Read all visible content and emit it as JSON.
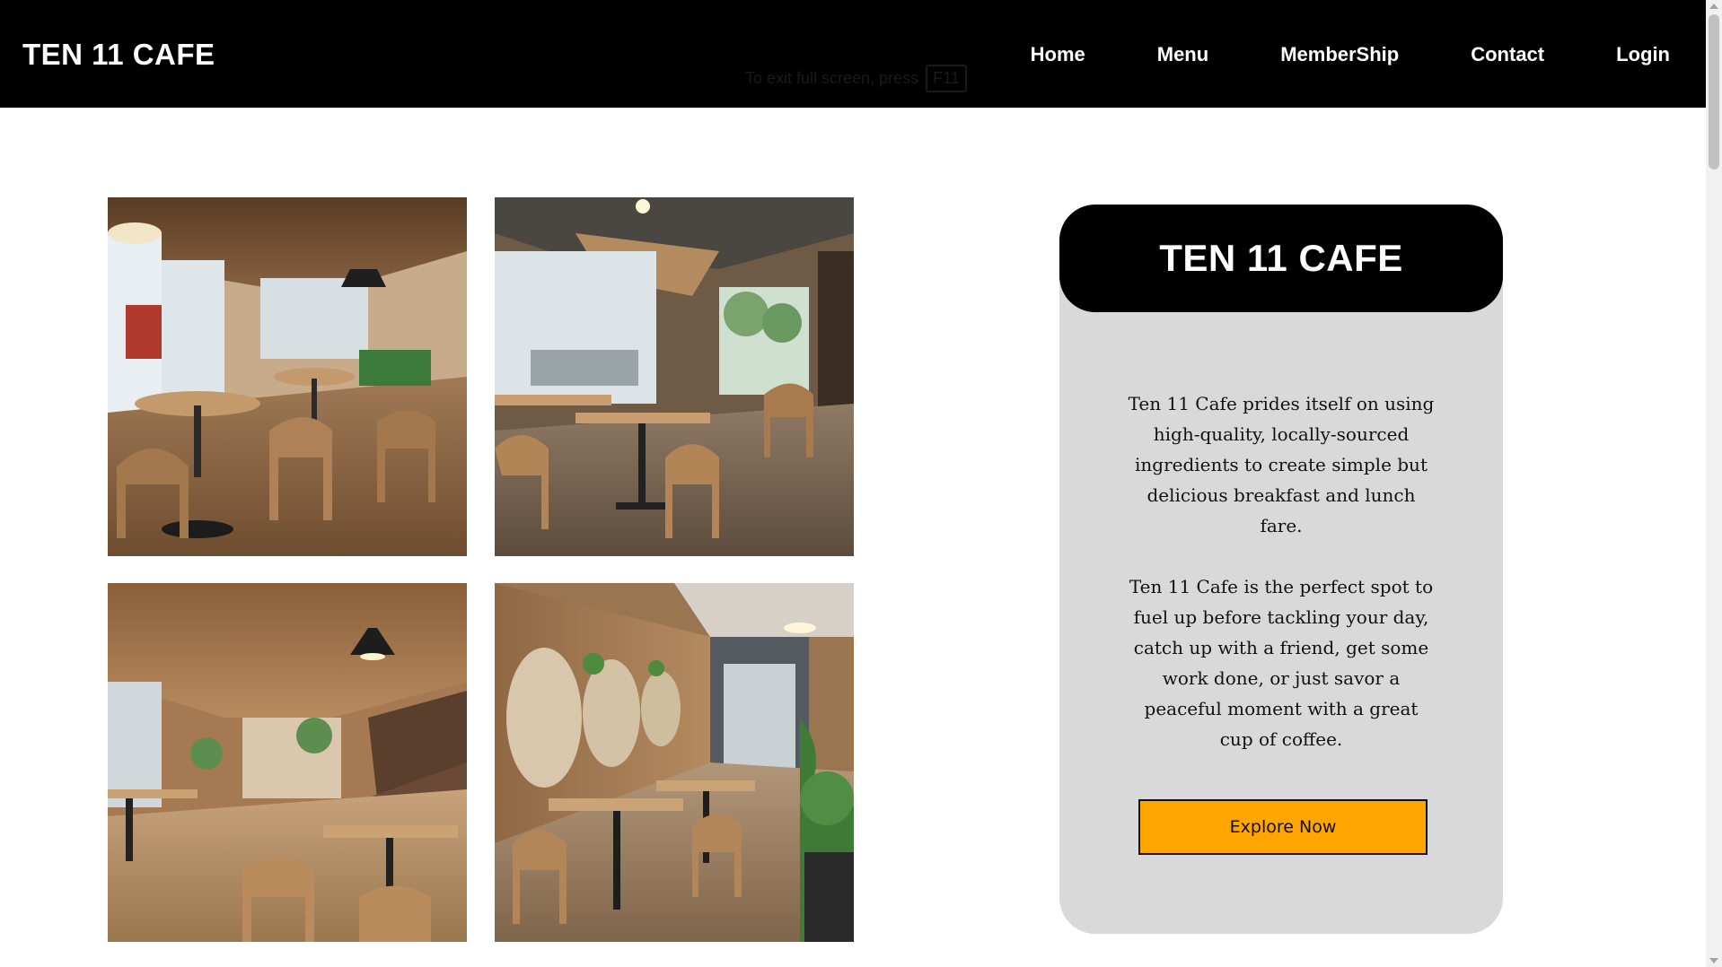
{
  "header": {
    "brand": "TEN 11 CAFE",
    "nav": [
      "Home",
      "Menu",
      "MemberShip",
      "Contact",
      "Login"
    ],
    "fullscreen_hint": {
      "text": "To exit full screen, press",
      "key": "F11"
    }
  },
  "gallery": [
    {
      "alt": "cafe interior with round tables and pendant lamps"
    },
    {
      "alt": "cafe interior with square tables by large windows"
    },
    {
      "alt": "cafe interior with wooden ceiling and booth seating"
    },
    {
      "alt": "cafe interior with carved wall panels and plants"
    }
  ],
  "card": {
    "title": "TEN 11 CAFE",
    "paragraphs": [
      "Ten 11 Cafe prides itself on using high-quality, locally-sourced ingredients to create simple but delicious breakfast and lunch fare.",
      "Ten 11 Cafe is the perfect spot to fuel up before tackling your day, catch up with a friend, get some work done, or just savor a peaceful moment with a great cup of coffee."
    ],
    "cta": "Explore Now"
  },
  "colors": {
    "header_bg": "#000000",
    "card_bg": "#d9d9d9",
    "cta_bg": "#ffa500"
  }
}
